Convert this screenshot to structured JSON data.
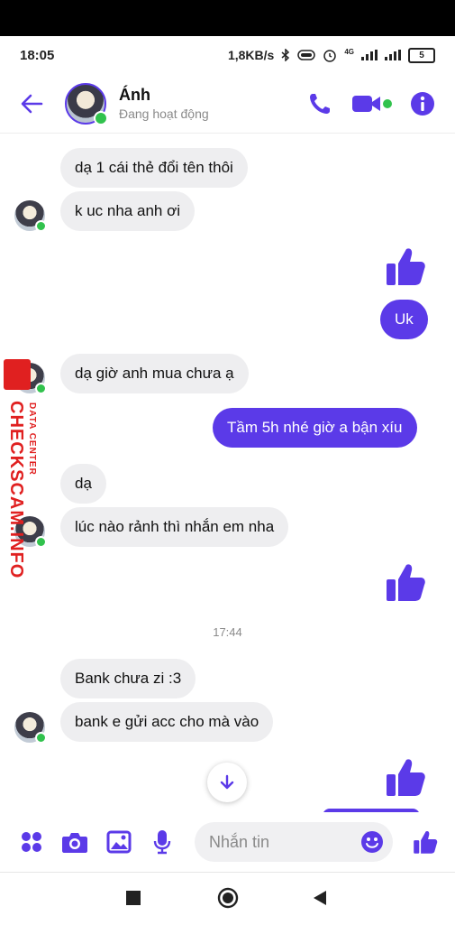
{
  "status": {
    "time": "18:05",
    "speed": "1,8KB/s",
    "network": "4G",
    "battery": "5"
  },
  "header": {
    "name": "Ánh",
    "status": "Đang hoạt động"
  },
  "messages": {
    "m1": "dạ 1 cái thẻ đổi tên thôi",
    "m2": "k uc nha anh ơi",
    "m3": "Uk",
    "m4": "dạ giờ anh  mua  chưa  ạ",
    "m5": "Tầm 5h nhé giờ a bận xíu",
    "m6": "dạ",
    "m7": "lúc nào rảnh thì nhắn em nha",
    "time": "17:44",
    "m8": "Bank chưa zi :3",
    "m9": "bank e gửi acc cho mà vào"
  },
  "watermark": {
    "main": "CHECKSCAM.INFO",
    "small": "DATA CENTER"
  },
  "composer": {
    "placeholder": "Nhắn tin"
  },
  "colors": {
    "accent": "#5b3ae8",
    "online": "#31c24d",
    "incoming": "#eeeef0"
  }
}
